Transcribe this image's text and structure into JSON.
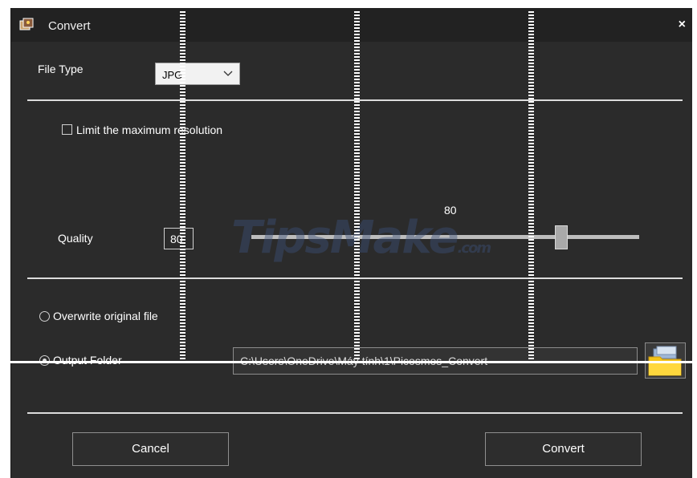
{
  "window": {
    "title": "Convert",
    "close_glyph": "×"
  },
  "file_type": {
    "label": "File Type",
    "selected": "JPG"
  },
  "limit_resolution": {
    "label": "Limit the maximum resolution",
    "checked": false
  },
  "quality": {
    "label": "Quality",
    "value": "80",
    "slider_display": "80",
    "slider_fraction": 0.8
  },
  "output": {
    "overwrite_label": "Overwrite original file",
    "folder_label": "Output Folder",
    "selected": "Output Folder",
    "path": "C:\\Users\\OneDrive\\Máy tính\\1\\Picosmos_Convert"
  },
  "buttons": {
    "cancel": "Cancel",
    "convert": "Convert"
  },
  "watermark": {
    "main": "TipsMake",
    "suffix": ".com"
  },
  "icons": {
    "app": "app-icon",
    "close": "close-icon",
    "chevron": "chevron-down-icon",
    "folder": "folder-icon"
  },
  "colors": {
    "background": "#2b2b2b",
    "titlebar": "#222222",
    "text": "#ffffff",
    "folder": "#f5c518"
  }
}
